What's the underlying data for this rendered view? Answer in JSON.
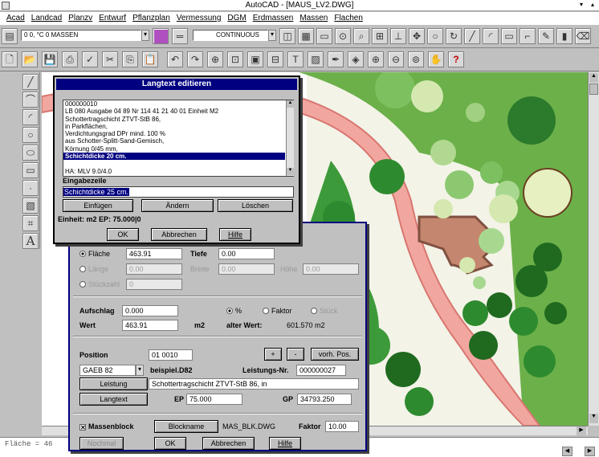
{
  "app": {
    "title": "AutoCAD - [MAUS_LV2.DWG]",
    "menu": [
      "Acad",
      "Landcad",
      "Planzv",
      "Entwurf",
      "Pflanzplan",
      "Vermessung",
      "DGM",
      "Erdmassen",
      "Massen",
      "Flachen"
    ],
    "layer_value": "0 0, °C 0 MASSEN",
    "linetype_value": "CONTINUOUS",
    "command_line": "Fläche = 46",
    "help_glyph": "?",
    "text_tool_glyph": "A"
  },
  "icons": {
    "toolbar1": [
      "layer-icon",
      "color-icon",
      "linetype-icon",
      "osnap-icon",
      "zoom-icon",
      "grid-icon",
      "ortho-icon",
      "move-icon",
      "circle-icon",
      "rotate-icon",
      "line-icon",
      "arc-icon",
      "rectangle-icon",
      "polyline-icon",
      "pencil-icon",
      "marker-icon",
      "eraser-icon"
    ],
    "toolbar2": [
      "new-icon",
      "open-icon",
      "save-icon",
      "print-icon",
      "spell-icon",
      "cut-icon",
      "copy-icon",
      "paste-icon",
      "undo-icon",
      "redo-icon",
      "snap-icon",
      "zoom-window-icon",
      "block-icon",
      "insert-icon",
      "text-icon",
      "hatch-icon",
      "pen-icon",
      "grip-icon",
      "zoom-in-icon",
      "zoom-out-icon",
      "zoom-all-icon",
      "pan-icon",
      "help-icon"
    ],
    "left_tools": [
      "line-tool-icon",
      "polyline-tool-icon",
      "arc-tool-icon",
      "circle-tool-icon",
      "ellipse-tool-icon",
      "rectangle-tool-icon",
      "point-tool-icon",
      "hatch-tool-icon",
      "dimension-tool-icon",
      "text-tool-icon"
    ]
  },
  "langtext_dialog": {
    "title": "Langtext editieren",
    "lines": [
      "000000010",
      "LB 080  Ausgabe 04 89  Nr  114 41 21 40 01  Einheit M2",
      "Schottertragschicht ZTVT-StB 86,",
      "in Parkflächen,",
      "Verdichtungsgrad DPr mind. 100 %",
      "aus Schotter-Splitt-Sand-Gemisch,",
      "Körnung 0/45 mm,",
      "Schichtdicke 20 cm.",
      "",
      "HA: MLV 9.0/4.0"
    ],
    "selected_index": 7,
    "input_label": "Eingabezeile",
    "input_value": "Schichtdicke 25 cm.",
    "btn_insert": "Einfügen",
    "btn_change": "Ändern",
    "btn_delete": "Löschen",
    "unit_text": "Einheit: m2    EP: 75.000|0",
    "btn_ok": "OK",
    "btn_cancel": "Abbrechen",
    "btn_help": "Hilfe"
  },
  "mass_dialog": {
    "radio_area": "Fläche",
    "area_value": "463.91",
    "depth_label": "Tiefe",
    "depth_value": "0.00",
    "radio_length": "Länge",
    "length_value": "0.00",
    "width_label": "Breite",
    "width_value": "0.00",
    "height_label": "Höhe",
    "height_value": "0.00",
    "radio_count": "Stückzahl",
    "count_value": "0",
    "markup_label": "Aufschlag",
    "markup_value": "0.000",
    "pct_label": "%",
    "factor_label": "Faktor",
    "piece_label": "Stück",
    "value_label": "Wert",
    "value_value": "463.91",
    "value_unit": "m2",
    "old_value_label": "alter Wert:",
    "old_value": "601.570 m2",
    "position_label": "Position",
    "position_value": "01 0010",
    "btn_plus": "+",
    "btn_minus": "-",
    "btn_prev": "vorh. Pos.",
    "catalog_value": "GAEB 82",
    "example_label": "beispiel.D82",
    "lnr_label": "Leistungs-Nr.",
    "lnr_value": "000000027",
    "btn_leistung": "Leistung",
    "leistung_value": "Schottertragschicht ZTVT-StB 86, in",
    "btn_langtext": "Langtext",
    "ep_label": "EP",
    "ep_value": "75.000",
    "gp_label": "GP",
    "gp_value": "34793.250",
    "mass_block_label": "Massenblock",
    "btn_blockname": "Blockname",
    "block_file": "MAS_BLK.DWG",
    "factor2_label": "Faktor",
    "factor2_value": "10.00",
    "btn_nochmal": "Nochmal",
    "btn_ok": "OK",
    "btn_cancel": "Abbrechen",
    "btn_help": "Hilfe"
  }
}
